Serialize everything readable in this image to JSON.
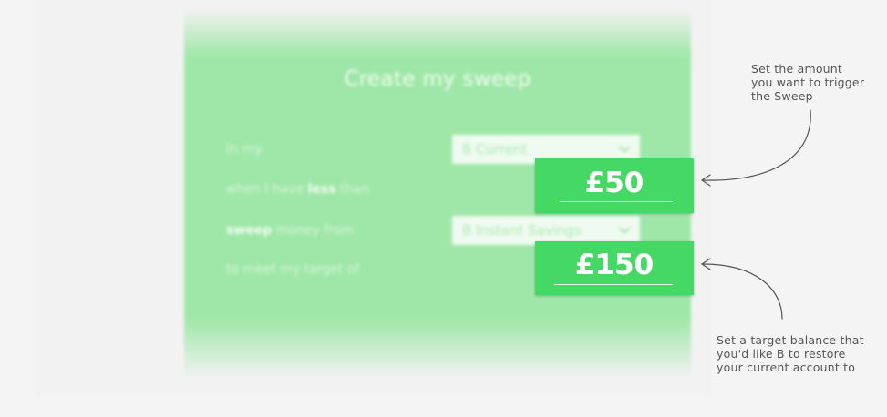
{
  "form": {
    "title": "Create my sweep",
    "row1": {
      "label": "In my",
      "select_value": "B Current"
    },
    "row2": {
      "label_pre": "when I have ",
      "label_bold": "less",
      "label_post": " than"
    },
    "row3": {
      "label_bold": "sweep",
      "label_post": " money from",
      "select_value": "B Instant Savings"
    },
    "row4": {
      "label": "to meet my target of"
    }
  },
  "amounts": {
    "trigger": "£50",
    "target": "£150"
  },
  "annotations": {
    "trigger_note": [
      "Set the amount",
      "you want to trigger",
      "the Sweep"
    ],
    "target_note": [
      "Set a target balance that",
      "you'd like B to restore",
      "your current account to"
    ]
  },
  "colors": {
    "panel_green": "#9fe7a8",
    "amount_green": "#45d864",
    "note_text": "#555555"
  },
  "icons": [
    "chevron-down-icon",
    "curved-arrow-icon"
  ]
}
